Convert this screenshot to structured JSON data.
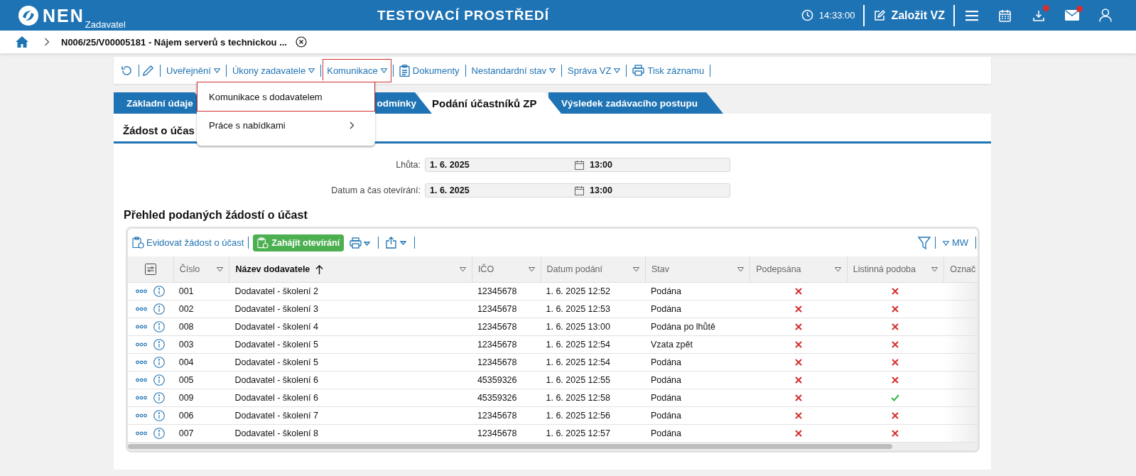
{
  "header": {
    "logo": "NEN",
    "subtitle": "Zadavatel",
    "title": "TESTOVACÍ PROSTŘEDÍ",
    "time": "14:33:00",
    "create_button": "Založit VZ",
    "icons": [
      {
        "kind": "menu",
        "badge": false
      },
      {
        "kind": "calendar",
        "badge": false
      },
      {
        "kind": "download",
        "badge": true
      },
      {
        "kind": "mail",
        "badge": true
      },
      {
        "kind": "user",
        "badge": false
      }
    ]
  },
  "breadcrumb": {
    "title": "N006/25/V00005181 - Nájem serverů s technickou ..."
  },
  "toolbar": {
    "items": [
      {
        "kind": "refresh"
      },
      {
        "kind": "edit"
      },
      {
        "kind": "menu",
        "label": "Uveřejnění",
        "expanded": false
      },
      {
        "kind": "menu",
        "label": "Úkony zadavatele",
        "expanded": false
      },
      {
        "kind": "menu",
        "label": "Komunikace",
        "expanded": true
      },
      {
        "kind": "documents",
        "label": "Dokumenty"
      },
      {
        "kind": "menu",
        "label": "Nestandardní stav",
        "expanded": false
      },
      {
        "kind": "menu",
        "label": "Správa VZ",
        "expanded": false
      },
      {
        "kind": "print",
        "label": "Tisk záznamu"
      }
    ]
  },
  "dropdown": {
    "items": [
      {
        "label": "Komunikace s dodavatelem",
        "selected": true,
        "submenu": false
      },
      {
        "label": "Práce s nabídkami",
        "selected": false,
        "submenu": true
      }
    ]
  },
  "tabs": [
    {
      "label": "Základní údaje",
      "selected": false
    },
    {
      "label": "odmínky",
      "selected": false
    },
    {
      "label": "Podání účastníků ZP",
      "selected": true
    },
    {
      "label": "Výsledek zadávacího postupu",
      "selected": false
    }
  ],
  "section_title": "Žádost o účas",
  "fields": [
    {
      "label": "Lhůta:",
      "date": "1. 6. 2025",
      "time": "13:00"
    },
    {
      "label": "Datum a čas otevírání:",
      "date": "1. 6. 2025",
      "time": "13:00"
    }
  ],
  "table_title": "Přehled podaných žádostí o účast",
  "table_toolbar": {
    "register_link": "Evidovat žádost o účast",
    "open_button": "Zahájit otevírání",
    "view_label": "MW"
  },
  "columns": [
    {
      "label": "Číslo",
      "sorted": false,
      "filter": true
    },
    {
      "label": "Název dodavatele",
      "sorted": true,
      "filter": true
    },
    {
      "label": "IČO",
      "sorted": false,
      "filter": true
    },
    {
      "label": "Datum podání",
      "sorted": false,
      "filter": true
    },
    {
      "label": "Stav",
      "sorted": false,
      "filter": true
    },
    {
      "label": "Podepsána",
      "sorted": false,
      "filter": true
    },
    {
      "label": "Listinná podoba",
      "sorted": false,
      "filter": true
    },
    {
      "label": "Označ",
      "sorted": false,
      "filter": false
    }
  ],
  "rows": [
    {
      "number": "001",
      "supplier": "Dodavatel - školení 2",
      "ico": "12345678",
      "submitted": "1. 6. 2025 12:52",
      "status": "Podána",
      "signed": false,
      "paper": false
    },
    {
      "number": "002",
      "supplier": "Dodavatel - školení 3",
      "ico": "12345678",
      "submitted": "1. 6. 2025 12:53",
      "status": "Podána",
      "signed": false,
      "paper": false
    },
    {
      "number": "008",
      "supplier": "Dodavatel - školení 4",
      "ico": "12345678",
      "submitted": "1. 6. 2025 13:00",
      "status": "Podána po lhůtě",
      "signed": false,
      "paper": false
    },
    {
      "number": "003",
      "supplier": "Dodavatel - školení 5",
      "ico": "12345678",
      "submitted": "1. 6. 2025 12:54",
      "status": "Vzata zpět",
      "signed": false,
      "paper": false
    },
    {
      "number": "004",
      "supplier": "Dodavatel - školení 5",
      "ico": "12345678",
      "submitted": "1. 6. 2025 12:54",
      "status": "Podána",
      "signed": false,
      "paper": false
    },
    {
      "number": "005",
      "supplier": "Dodavatel - školení 6",
      "ico": "45359326",
      "submitted": "1. 6. 2025 12:55",
      "status": "Podána",
      "signed": false,
      "paper": false
    },
    {
      "number": "009",
      "supplier": "Dodavatel - školení 6",
      "ico": "45359326",
      "submitted": "1. 6. 2025 12:58",
      "status": "Podána",
      "signed": false,
      "paper": true
    },
    {
      "number": "006",
      "supplier": "Dodavatel - školení 7",
      "ico": "12345678",
      "submitted": "1. 6. 2025 12:56",
      "status": "Podána",
      "signed": false,
      "paper": false
    },
    {
      "number": "007",
      "supplier": "Dodavatel - školení 8",
      "ico": "12345678",
      "submitted": "1. 6. 2025 12:57",
      "status": "Podána",
      "signed": false,
      "paper": false
    }
  ]
}
